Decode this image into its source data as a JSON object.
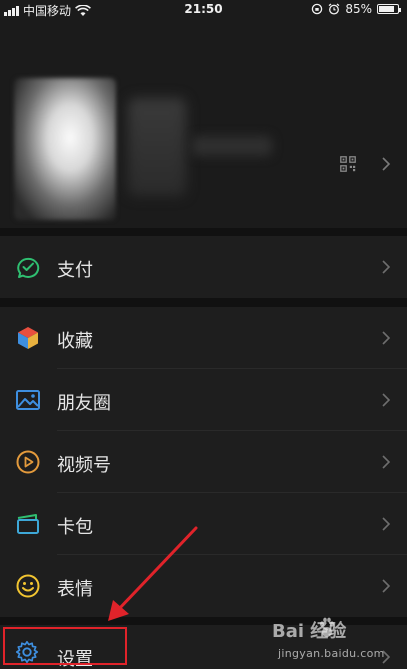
{
  "status_bar": {
    "carrier": "中国移动",
    "time": "21:50",
    "battery_percent": "85%",
    "battery_level": 0.85
  },
  "profile": {
    "qr_icon": "qr-code-icon",
    "chevron_icon": "chevron-right-icon"
  },
  "menu": [
    {
      "label": "支付",
      "icon": "payment-icon",
      "color": "#2fbf71"
    },
    {
      "label": "收藏",
      "icon": "favorites-cube-icon",
      "color": "#e8b13f"
    },
    {
      "label": "朋友圈",
      "icon": "moments-image-icon",
      "color": "#3e8fe0"
    },
    {
      "label": "视频号",
      "icon": "channels-play-icon",
      "color": "#e39a3c"
    },
    {
      "label": "卡包",
      "icon": "card-wallet-icon",
      "color": "#3ea8d8"
    },
    {
      "label": "表情",
      "icon": "sticker-smile-icon",
      "color": "#f2c531"
    },
    {
      "label": "设置",
      "icon": "settings-gear-icon",
      "color": "#3e8fe0"
    }
  ],
  "annotation": {
    "highlight_color": "#e0232a"
  },
  "watermark": {
    "logo": "Bai  经验",
    "url": "jingyan.baidu.com"
  }
}
